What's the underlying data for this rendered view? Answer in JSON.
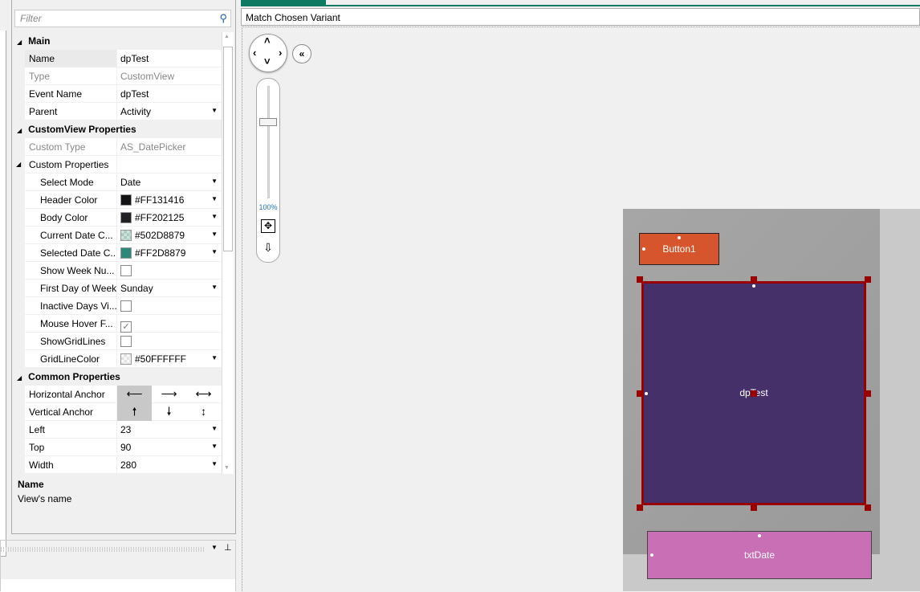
{
  "filter": {
    "placeholder": "Filter"
  },
  "properties": {
    "main": "Main",
    "name_label": "Name",
    "name_value": "dpTest",
    "type_label": "Type",
    "type_value": "CustomView",
    "event_label": "Event Name",
    "event_value": "dpTest",
    "parent_label": "Parent",
    "parent_value": "Activity",
    "cv": "CustomView Properties",
    "ctype_label": "Custom Type",
    "ctype_value": "AS_DatePicker",
    "cprops": "Custom Properties",
    "selmode_label": "Select Mode",
    "selmode_value": "Date",
    "header_label": "Header Color",
    "header_value": "#FF131416",
    "header_color": "#131416",
    "body_label": "Body Color",
    "body_value": "#FF202125",
    "body_color": "#202125",
    "cur_label": "Current Date C...",
    "cur_value": "#502D8879",
    "cur_color": "#b7d1c9",
    "selc_label": "Selected Date C...",
    "selc_value": "#FF2D8879",
    "selc_color": "#2d8879",
    "week_label": "Show Week Nu...",
    "first_label": "First Day of Week",
    "first_value": "Sunday",
    "inactive_label": "Inactive Days Vi...",
    "hover_label": "Mouse Hover F...",
    "hover_check": "✓",
    "grid_label": "ShowGridLines",
    "gridc_label": "GridLineColor",
    "gridc_value": "#50FFFFFF",
    "gridc_color": "#eeeeee",
    "common": "Common Properties",
    "hanchor_label": "Horizontal Anchor",
    "vanchor_label": "Vertical Anchor",
    "left_label": "Left",
    "left_value": "23",
    "top_label": "Top",
    "top_value": "90",
    "width_label": "Width",
    "width_value": "280"
  },
  "description": {
    "title": "Name",
    "text": "View's name"
  },
  "designer": {
    "variant": "Match Chosen Variant",
    "zoom": "100%"
  },
  "views": {
    "button1": "Button1",
    "dp": "dpTest",
    "txt": "txtDate"
  }
}
